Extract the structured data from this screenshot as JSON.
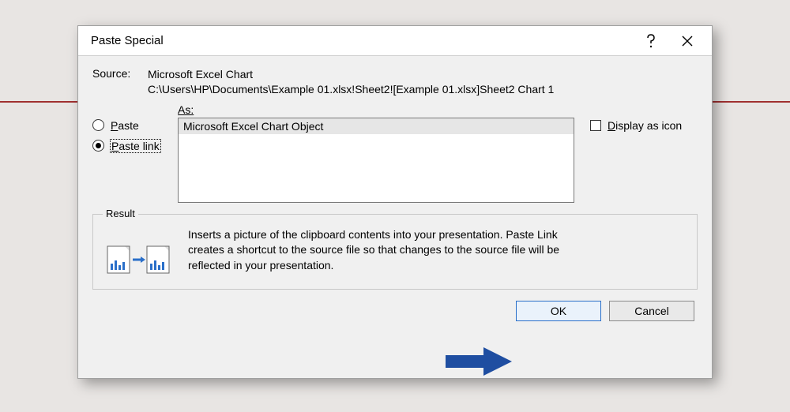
{
  "dialog": {
    "title": "Paste Special",
    "source_label": "Source:",
    "source_line1": "Microsoft Excel Chart",
    "source_line2": "C:\\Users\\HP\\Documents\\Example 01.xlsx!Sheet2![Example 01.xlsx]Sheet2 Chart 1",
    "as_label": "As:",
    "paste_prefix": "P",
    "paste_rest": "aste",
    "paste_link_rest": "aste link",
    "list_items": [
      "Microsoft Excel Chart Object"
    ],
    "display_icon_prefix": "D",
    "display_icon_rest": "isplay as icon",
    "result_label": "Result",
    "result_text": "Inserts a picture of the clipboard contents into your presentation. Paste Link creates a shortcut to the source file so that changes to the source file will be reflected in your presentation.",
    "ok_label": "OK",
    "cancel_label": "Cancel"
  }
}
